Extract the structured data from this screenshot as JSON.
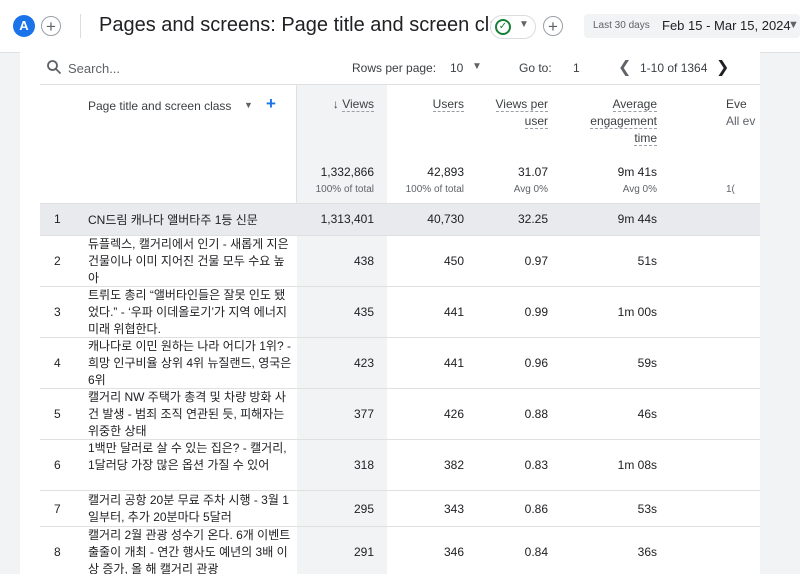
{
  "header": {
    "account_initial": "A",
    "title": "Pages and screens: Page title and screen class",
    "date_label": "Last 30 days",
    "date_range": "Feb 15 - Mar 15, 2024"
  },
  "toolbar": {
    "search_placeholder": "Search...",
    "rows_per_page_label": "Rows per page:",
    "rows_per_page_value": "10",
    "goto_label": "Go to:",
    "goto_value": "1",
    "page_range": "1-10 of 1364"
  },
  "table": {
    "dimension_header": "Page title and screen class",
    "columns": [
      {
        "label": "Views",
        "sorted": true,
        "total": "1,332,866",
        "sub": "100% of total"
      },
      {
        "label": "Users",
        "total": "42,893",
        "sub": "100% of total"
      },
      {
        "label": "Views per user",
        "total": "31.07",
        "sub": "Avg 0%"
      },
      {
        "label": "Average engagement time",
        "total": "9m 41s",
        "sub": "Avg 0%"
      },
      {
        "label": "Eve",
        "label2": "All ev",
        "total": "",
        "sub": "1("
      }
    ],
    "rows": [
      {
        "n": "1",
        "title": "CN드림 캐나다 앨버타주 1등 신문",
        "views": "1,313,401",
        "users": "40,730",
        "vpu": "32.25",
        "aet": "9m 44s"
      },
      {
        "n": "2",
        "title": "듀플렉스, 캘거리에서 인기 - 새롭게 지은 건물이나 이미 지어진 건물 모두 수요 높아",
        "views": "438",
        "users": "450",
        "vpu": "0.97",
        "aet": "51s"
      },
      {
        "n": "3",
        "title": "트뤼도 총리 “앨버타인들은 잘못 인도 됐었다.” - ‘우파 이데올로기’가 지역 에너지 미래 위협한다.",
        "views": "435",
        "users": "441",
        "vpu": "0.99",
        "aet": "1m 00s"
      },
      {
        "n": "4",
        "title": "캐나다로 이민 원하는 나라 어디가 1위? - 희망 인구비율 상위 4위 뉴질랜드, 영국은 6위",
        "views": "423",
        "users": "441",
        "vpu": "0.96",
        "aet": "59s"
      },
      {
        "n": "5",
        "title": "캘거리 NW 주택가 총격 및 차량 방화 사건 발생 - 범죄 조직 연관된 듯, 피해자는 위중한 상태",
        "views": "377",
        "users": "426",
        "vpu": "0.88",
        "aet": "46s"
      },
      {
        "n": "6",
        "title": "1백만 달러로 살 수 있는 집은? - 캘거리, 1달러당 가장 많은 옵션 가질 수 있어",
        "views": "318",
        "users": "382",
        "vpu": "0.83",
        "aet": "1m 08s"
      },
      {
        "n": "7",
        "title": "캘거리 공항 20분 무료 주차 시행 - 3월 1일부터, 추가 20분마다 5달러",
        "views": "295",
        "users": "343",
        "vpu": "0.86",
        "aet": "53s"
      },
      {
        "n": "8",
        "title": "캘거리 2월 관광 성수기 온다. 6개 이벤트 출줄이 개최 - 연간 행사도 예년의 3배 이상 증가, 올 해 캘거리 관광",
        "views": "291",
        "users": "346",
        "vpu": "0.84",
        "aet": "36s"
      }
    ]
  },
  "colors": {
    "accent": "#1a73e8",
    "ok": "#188038",
    "shade": "#f1f3f4"
  }
}
